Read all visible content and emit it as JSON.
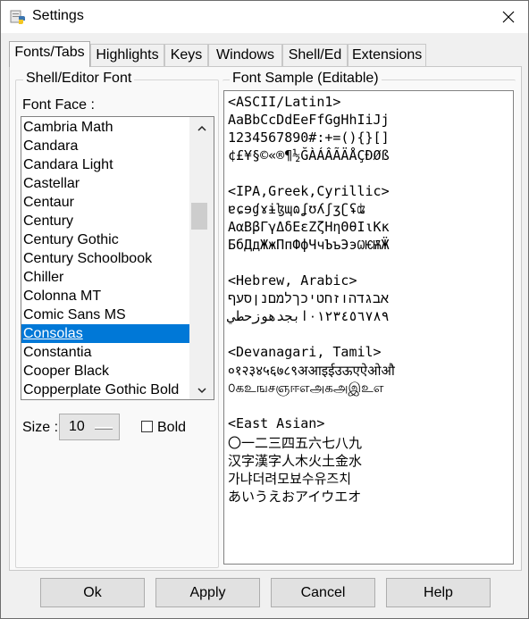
{
  "window": {
    "title": "Settings",
    "app_icon": "python-idle-icon",
    "close_icon": "close-icon"
  },
  "tabs": [
    {
      "label": "Fonts/Tabs",
      "active": true
    },
    {
      "label": "Highlights",
      "active": false
    },
    {
      "label": "Keys",
      "active": false
    },
    {
      "label": "Windows",
      "active": false
    },
    {
      "label": "Shell/Ed",
      "active": false
    },
    {
      "label": "Extensions",
      "active": false
    }
  ],
  "font_panel": {
    "group_title": "Shell/Editor Font",
    "font_face_label": "Font Face :",
    "fonts": [
      "Cambria Math",
      "Candara",
      "Candara Light",
      "Castellar",
      "Centaur",
      "Century",
      "Century Gothic",
      "Century Schoolbook",
      "Chiller",
      "Colonna MT",
      "Comic Sans MS",
      "Consolas",
      "Constantia",
      "Cooper Black",
      "Copperplate Gothic Bold"
    ],
    "selected_font": "Consolas",
    "size_label": "Size :",
    "size_value": "10",
    "bold_label": "Bold",
    "bold_checked": false
  },
  "sample_panel": {
    "group_title": "Font Sample (Editable)",
    "lines": [
      "<ASCII/Latin1>",
      "AaBbCcDdEeFfGgHhIiJj",
      "1234567890#:+=(){}[]",
      "¢£¥§©«®¶½ĞÀÁÂÃÄÅÇÐØß",
      "",
      "<IPA,Greek,Cyrillic>",
      "ɐɕɘɠɤɨɮɰɷʆʊʎʃʒʗʢʥ",
      "ΑαΒβΓγΔδΕεΖζΗηΘθΙιΚκ",
      "БбДдЖжПпФфЧчЪъЭэѠѤѬӜ",
      "",
      "<Hebrew, Arabic>",
      "אבגדהוזחטיכךלמםנןסעף",
      "٠١٢٣٤٥٦٧٨٩ابجدهوزحطي",
      "",
      "<Devanagari, Tamil>",
      "०१२३४५६७८९अआइईउऊएऐओऔ",
      "௦கஉஙசஞஈஎஅகஅஇஉஎ",
      "",
      "<East Asian>",
      "〇一二三四五六七八九",
      "汉字漢字人木火土金水",
      "가냐더려모뵤수유즈치",
      "あいうえおアイウエオ"
    ]
  },
  "buttons": {
    "ok": "Ok",
    "apply": "Apply",
    "cancel": "Cancel",
    "help": "Help"
  },
  "colors": {
    "selection": "#0078d7",
    "panel": "#f9f9f9",
    "window": "#f0f0f0"
  }
}
